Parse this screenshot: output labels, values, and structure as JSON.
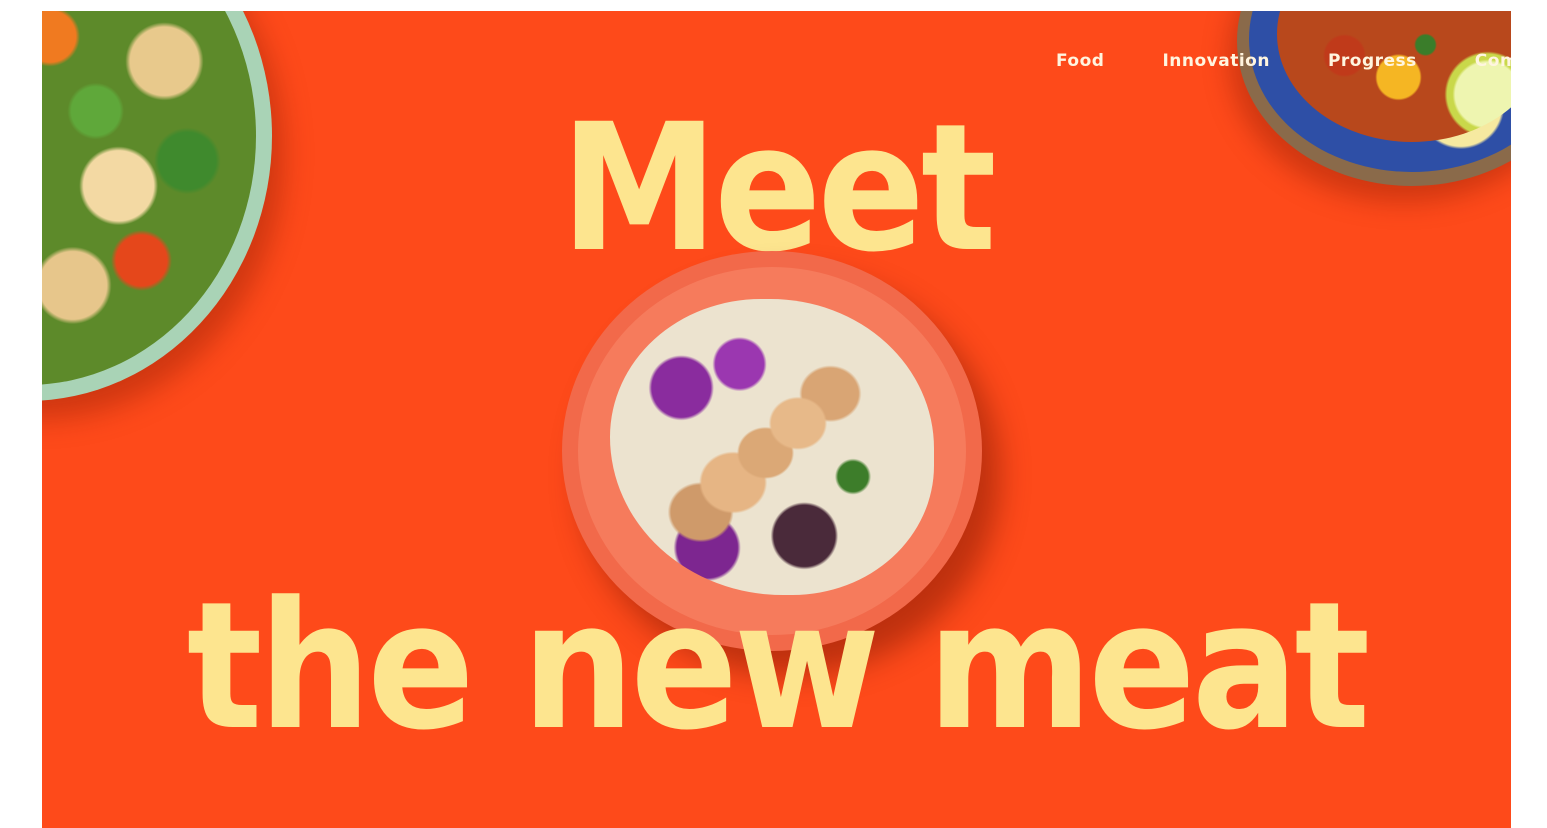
{
  "nav": {
    "items": [
      {
        "label": "Food"
      },
      {
        "label": "Innovation"
      },
      {
        "label": "Progress"
      },
      {
        "label": "Compa"
      }
    ]
  },
  "hero": {
    "line1": "Meet",
    "line2": "the new meat"
  },
  "colors": {
    "background": "#fe4a1a",
    "headline": "#fde58f",
    "nav_text": "#fff5df"
  }
}
